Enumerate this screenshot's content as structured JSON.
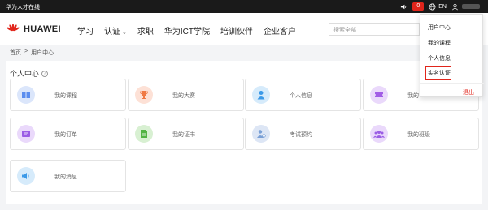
{
  "topbar": {
    "brand": "华为人才在线",
    "notification_count": "0",
    "lang": "EN"
  },
  "header": {
    "logo_text": "HUAWEI",
    "nav": [
      "学习",
      "认证",
      "求职",
      "华为ICT学院",
      "培训伙伴",
      "企业客户"
    ],
    "search_placeholder": "搜索全部"
  },
  "breadcrumb": {
    "home": "首页",
    "sep": ">",
    "current": "用户中心"
  },
  "section": {
    "title": "个人中心"
  },
  "cards": [
    {
      "label": "我的课程",
      "icon": "book-icon",
      "color": "#dbe6fb",
      "fg": "#5b8def"
    },
    {
      "label": "我的大赛",
      "icon": "trophy-icon",
      "color": "#fde1d6",
      "fg": "#f07a45"
    },
    {
      "label": "个人信息",
      "icon": "person-icon",
      "color": "#d6ebfb",
      "fg": "#3c9ae8"
    },
    {
      "label": "我的",
      "icon": "ticket-icon",
      "color": "#ead9fb",
      "fg": "#a25de6"
    },
    {
      "label": "我的订单",
      "icon": "order-icon",
      "color": "#ead9fb",
      "fg": "#9b5de5"
    },
    {
      "label": "我的证书",
      "icon": "certificate-icon",
      "color": "#d8f0d2",
      "fg": "#52b343"
    },
    {
      "label": "考试预约",
      "icon": "exam-booking-icon",
      "color": "#dde6f5",
      "fg": "#7aa0d6"
    },
    {
      "label": "我的班级",
      "icon": "group-icon",
      "color": "#ead9fb",
      "fg": "#9b5de5"
    },
    {
      "label": "我的消息",
      "icon": "speaker-icon",
      "color": "#d6ebfb",
      "fg": "#3c9ae8"
    }
  ],
  "dropdown": {
    "items": [
      "用户中心",
      "我的课程",
      "个人信息",
      "实名认证"
    ],
    "logout": "退出"
  }
}
